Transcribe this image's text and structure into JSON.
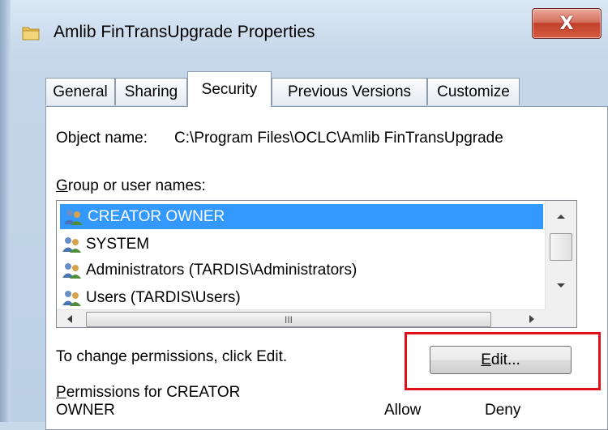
{
  "window": {
    "title": "Amlib FinTransUpgrade Properties",
    "close_glyph": "X",
    "close_color": "#c2402b"
  },
  "tabs": [
    {
      "label": "General",
      "active": false
    },
    {
      "label": "Sharing",
      "active": false
    },
    {
      "label": "Security",
      "active": true
    },
    {
      "label": "Previous Versions",
      "active": false
    },
    {
      "label": "Customize",
      "active": false
    }
  ],
  "security": {
    "object_name_label": "Object name:",
    "object_name_value": "C:\\Program Files\\OCLC\\Amlib FinTransUpgrade",
    "group_label": "Group or user names:",
    "group_label_accel": "G",
    "group_label_rest": "roup or user names:",
    "users": [
      {
        "name": "CREATOR OWNER",
        "selected": true,
        "icon": "users-icon"
      },
      {
        "name": "SYSTEM",
        "selected": false,
        "icon": "users-icon"
      },
      {
        "name": "Administrators (TARDIS\\Administrators)",
        "selected": false,
        "icon": "users-icon"
      },
      {
        "name": "Users (TARDIS\\Users)",
        "selected": false,
        "icon": "users-icon"
      }
    ],
    "hscroll_grip": "III",
    "change_hint": "To change permissions, click Edit.",
    "edit_button_accel": "E",
    "edit_button_rest": "dit...",
    "edit_button_label": "Edit...",
    "permissions_label_line1_accel": "P",
    "permissions_label_line1_rest": "ermissions for CREATOR",
    "permissions_label_line2": "OWNER",
    "allow_header": "Allow",
    "deny_header": "Deny",
    "selection_color": "#3399ff",
    "highlight_color": "#e0101a"
  }
}
